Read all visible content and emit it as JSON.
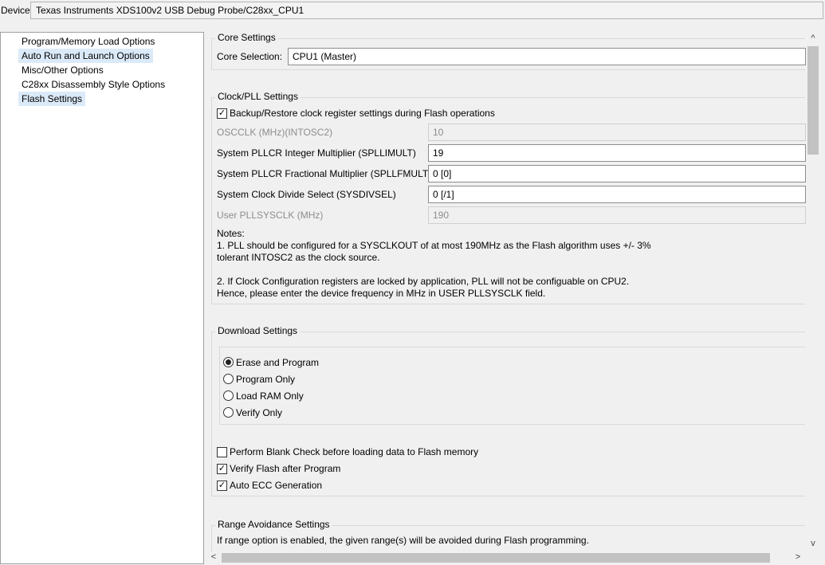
{
  "device": {
    "label": "Device",
    "value": "Texas Instruments XDS100v2 USB Debug Probe/C28xx_CPU1"
  },
  "tree": {
    "items": [
      {
        "label": "Program/Memory Load Options"
      },
      {
        "label": "Auto Run and Launch Options"
      },
      {
        "label": "Misc/Other Options"
      },
      {
        "label": "C28xx Disassembly Style Options"
      },
      {
        "label": "Flash Settings"
      }
    ]
  },
  "core": {
    "title": "Core Settings",
    "selection_label": "Core Selection:",
    "selection_value": "CPU1 (Master)"
  },
  "clock": {
    "title": "Clock/PLL Settings",
    "backup_label": "Backup/Restore clock register settings during Flash operations",
    "backup_checked": true,
    "oscclk_label": "OSCCLK (MHz)(INTOSC2)",
    "oscclk_value": "10",
    "spllimult_label": "System PLLCR Integer Multiplier (SPLLIMULT)",
    "spllimult_value": "19",
    "spllfmult_label": "System PLLCR Fractional Multiplier (SPLLFMULT)",
    "spllfmult_value": "0 [0]",
    "sysdivsel_label": "System Clock Divide Select (SYSDIVSEL)",
    "sysdivsel_value": "0 [/1]",
    "pllsysclk_label": "User PLLSYSCLK (MHz)",
    "pllsysclk_value": "190",
    "notes_title": "Notes:",
    "note1_line1": "1. PLL should be configured for a SYSCLKOUT of at most 190MHz as the Flash algorithm uses +/- 3%",
    "note1_line2": "tolerant INTOSC2 as the clock source.",
    "note2_line1": "2. If Clock Configuration registers are locked by application, PLL will not be configuable on CPU2.",
    "note2_line2": "Hence, please enter the device frequency in MHz in USER PLLSYSCLK field."
  },
  "download": {
    "title": "Download Settings",
    "options": [
      {
        "label": "Erase and Program",
        "selected": true
      },
      {
        "label": "Program Only",
        "selected": false
      },
      {
        "label": "Load RAM Only",
        "selected": false
      },
      {
        "label": "Verify Only",
        "selected": false
      }
    ],
    "blank_check_label": "Perform Blank Check before loading data to Flash memory",
    "blank_check_checked": false,
    "verify_label": "Verify Flash after Program",
    "verify_checked": true,
    "ecc_label": "Auto ECC Generation",
    "ecc_checked": true
  },
  "range": {
    "title": "Range Avoidance Settings",
    "text": "If range option is enabled, the given range(s) will be avoided during Flash programming."
  },
  "scroll": {
    "up_arrow": "^",
    "down_arrow": "v",
    "left_arrow": "<",
    "right_arrow": ">"
  }
}
